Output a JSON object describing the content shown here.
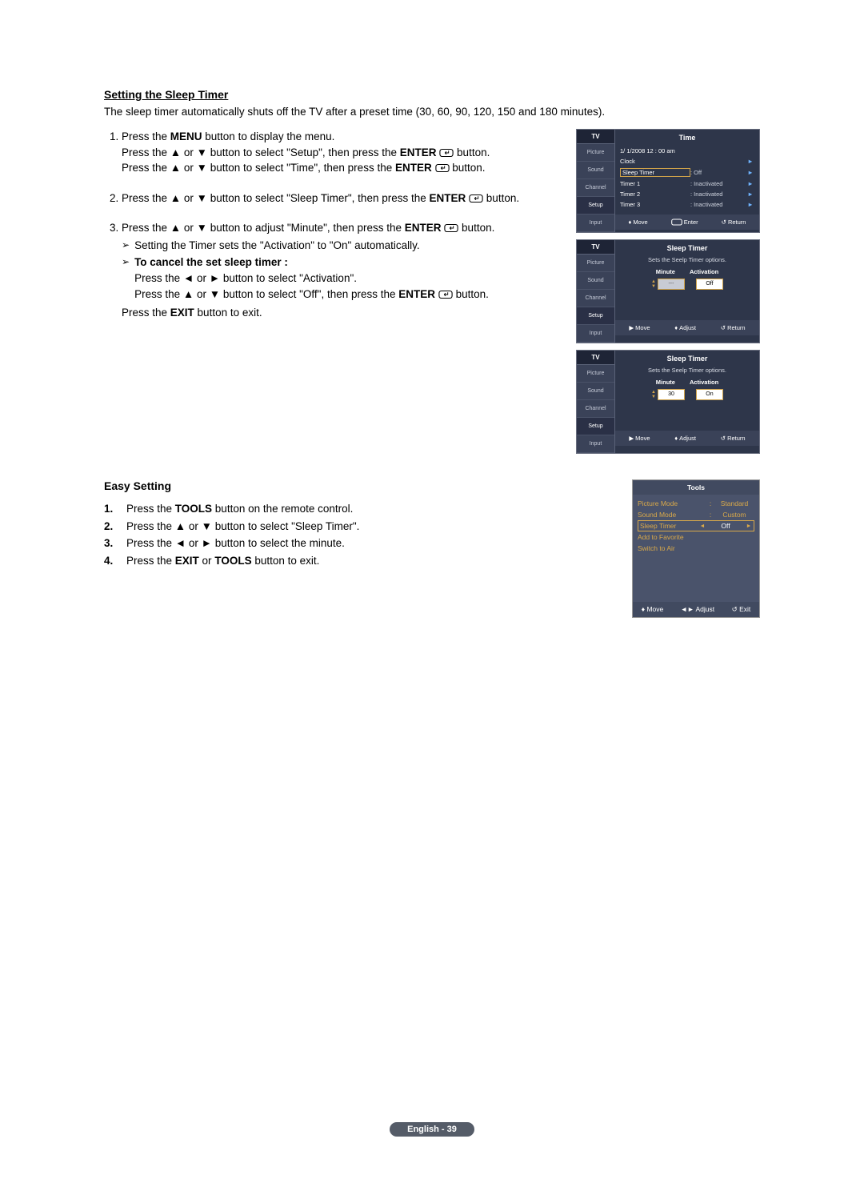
{
  "section1": {
    "heading": "Setting the Sleep Timer",
    "intro": "The sleep timer automatically shuts off the TV after a preset time (30, 60, 90, 120, 150 and 180 minutes).",
    "step1_a": "Press the ",
    "step1_menu": "MENU",
    "step1_b": " button to display the menu.",
    "step1_c": "Press the ▲ or ▼ button to select \"Setup\", then press the ",
    "step1_enter": "ENTER",
    "step1_d": " button.",
    "step1_e": "Press the ▲ or ▼ button to select \"Time\", then press the ",
    "step2_a": "Press the ▲ or ▼ button to select \"Sleep Timer\", then press the ",
    "step3_a": "Press the ▲ or ▼ button to adjust \"Minute\", then press the ",
    "step3_sub": "Setting the Timer sets the \"Activation\" to \"On\" automatically.",
    "cancel_label": "To cancel the set sleep timer :",
    "cancel_a": "Press the ◄ or ► button to select \"Activation\".",
    "cancel_b": "Press the ▲ or ▼ button to select \"Off\", then press the ",
    "exit_a": "Press the ",
    "exit_b": "EXIT",
    "exit_c": " button to exit."
  },
  "osd1": {
    "tv": "TV",
    "title": "Time",
    "datetime": "1/   1/2008  12 : 00 am",
    "side": [
      "Picture",
      "Sound",
      "Channel",
      "Setup",
      "Input"
    ],
    "rows": [
      {
        "label": "Clock",
        "val": "",
        "arrow": "►"
      },
      {
        "label": "Sleep Timer",
        "val": ": Off",
        "arrow": "►",
        "hl": true
      },
      {
        "label": "Timer 1",
        "val": ": Inactivated",
        "arrow": "►"
      },
      {
        "label": "Timer 2",
        "val": ": Inactivated",
        "arrow": "►"
      },
      {
        "label": "Timer 3",
        "val": ": Inactivated",
        "arrow": "►"
      }
    ],
    "footer": {
      "move": "Move",
      "enter": "Enter",
      "ret": "Return"
    }
  },
  "osd2": {
    "tv": "TV",
    "title": "Sleep Timer",
    "subtitle": "Sets the Seelp Timer options.",
    "side": [
      "Picture",
      "Sound",
      "Channel",
      "Setup",
      "Input"
    ],
    "head_min": "Minute",
    "head_act": "Activation",
    "val_min": "---",
    "val_act": "Off",
    "footer": {
      "move": "Move",
      "adj": "Adjust",
      "ret": "Return"
    }
  },
  "osd3": {
    "tv": "TV",
    "title": "Sleep Timer",
    "subtitle": "Sets the Seelp Timer options.",
    "side": [
      "Picture",
      "Sound",
      "Channel",
      "Setup",
      "Input"
    ],
    "head_min": "Minute",
    "head_act": "Activation",
    "val_min": "30",
    "val_act": "On",
    "footer": {
      "move": "Move",
      "adj": "Adjust",
      "ret": "Return"
    }
  },
  "easy": {
    "heading": "Easy Setting",
    "s1a": "Press the ",
    "s1b": "TOOLS",
    "s1c": " button on the remote control.",
    "s2": "Press the ▲ or ▼ button to select \"Sleep Timer\".",
    "s3": "Press the ◄ or ► button to select the minute.",
    "s4a": "Press the ",
    "s4b": "EXIT",
    "s4c": " or ",
    "s4d": "TOOLS",
    "s4e": " button to exit.",
    "n1": "1.",
    "n2": "2.",
    "n3": "3.",
    "n4": "4."
  },
  "tools": {
    "title": "Tools",
    "rows": [
      {
        "label": "Picture Mode",
        "val": "Standard"
      },
      {
        "label": "Sound Mode",
        "val": "Custom"
      },
      {
        "label": "Sleep Timer",
        "val": "Off",
        "sel": true
      },
      {
        "label": "Add to Favorite",
        "val": ""
      },
      {
        "label": "Switch to Air",
        "val": ""
      }
    ],
    "footer": {
      "move": "Move",
      "adj": "Adjust",
      "exit": "Exit"
    }
  },
  "footer": {
    "text": "English - 39"
  }
}
